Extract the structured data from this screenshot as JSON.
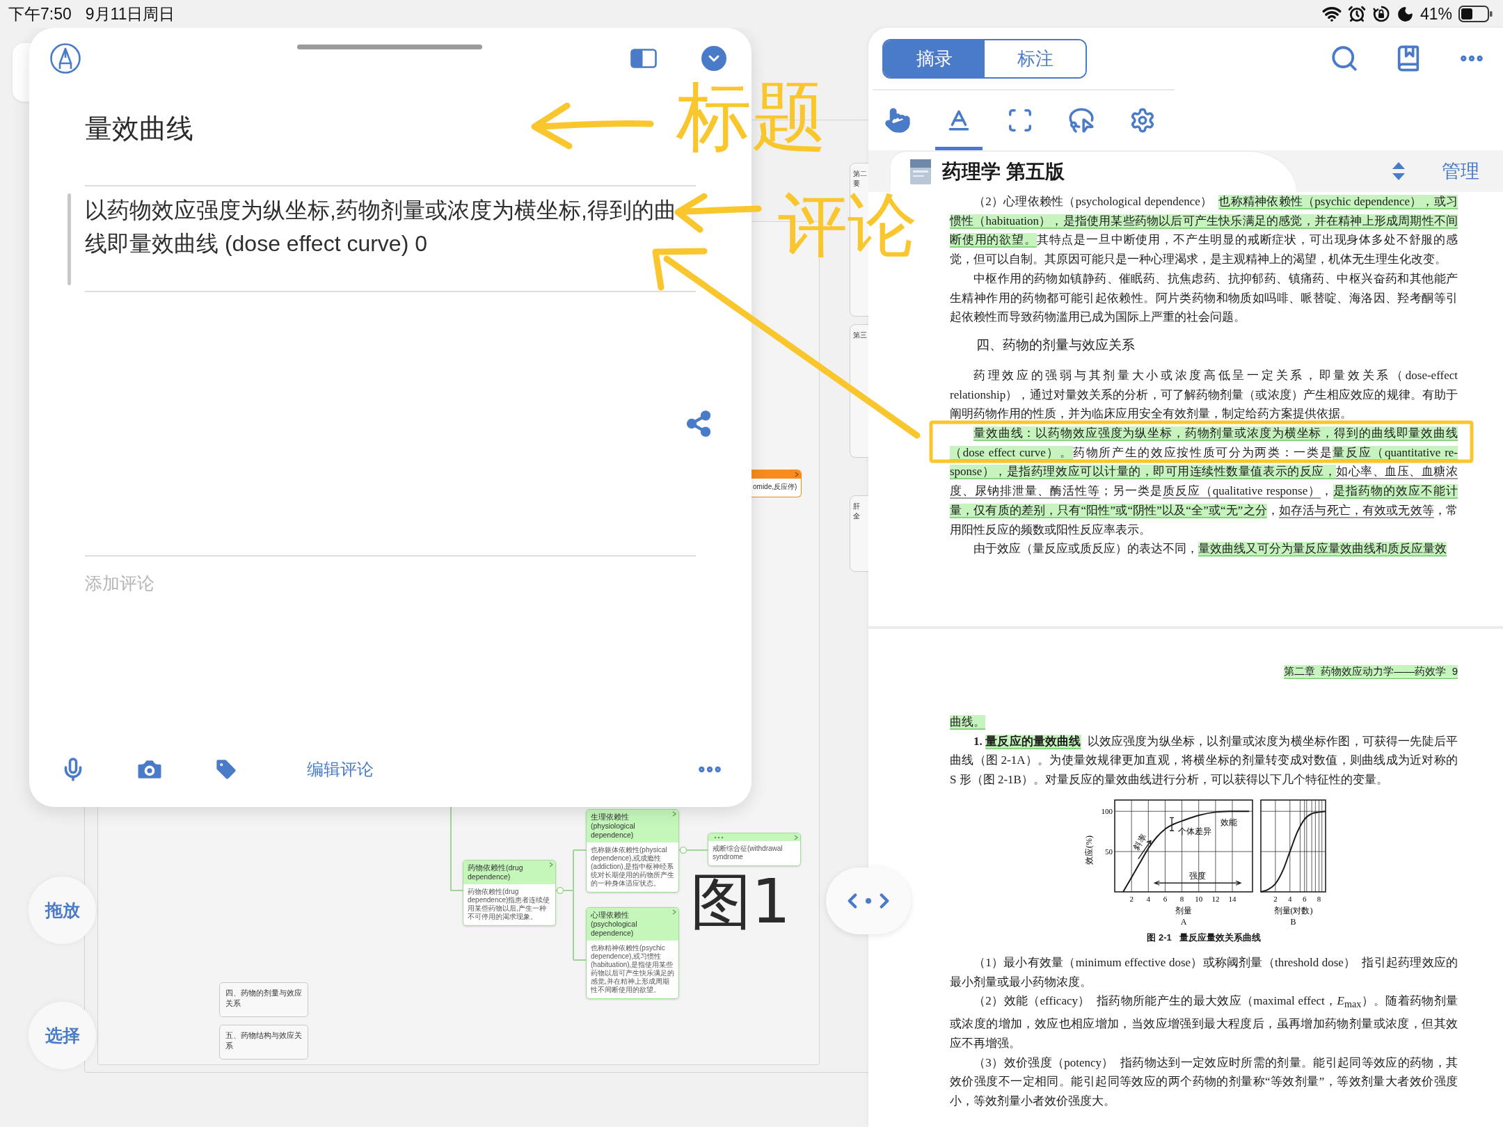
{
  "status_bar": {
    "time": "下午7:50",
    "date": "9月11日周日",
    "battery": "41%"
  },
  "note_card": {
    "title": "量效曲线",
    "excerpt": "以药物效应强度为纵坐标,药物剂量或浓度为横坐标,得到的曲线即量效曲线 (dose effect curve) 0",
    "comment_field": {
      "placeholder": "添加评论"
    },
    "edit_button": "编辑评论"
  },
  "side_buttons": [
    {
      "label": "拖放"
    },
    {
      "label": "选择"
    }
  ],
  "mind_map": {
    "topics": [
      {
        "title": "药物依赖性(drug dependence)",
        "body": "药物依赖性(drug dependence)指患者连续使用某些药物以后,产生一种不可停用的渴求现象。"
      },
      {
        "title": "生理依赖性(physiological dependence)",
        "body": "也称躯体依赖性(physical dependence),或成瘾性(addiction),是指中枢神经系统对长期使用的药物所产生的一种身体适应状态。"
      },
      {
        "title": "心理依赖性(psychological dependence)",
        "body": "也称精神依赖性(psychic dependence),或习惯性(habituation),是指使用某些药物以后可产生快乐满足的感觉,并在精神上形成周期性不间断使用的欲望。"
      }
    ],
    "note": {
      "text": "戒断综合征(withdrawal syndrome"
    },
    "sections": [
      "四、药物的剂量与效应关系",
      "五、药物结构与效应关系"
    ],
    "edge_nodes": [
      {
        "lines": [
          "第二",
          "要"
        ]
      },
      {
        "lines": [
          "第三"
        ]
      },
      {
        "lines": [
          "肝",
          "全"
        ]
      }
    ],
    "marked_node": {
      "text": "omide,反应停)"
    }
  },
  "reader": {
    "tabs": [
      {
        "label": "摘录",
        "selected": true
      },
      {
        "label": "标注",
        "selected": false
      }
    ],
    "tools": [
      {
        "kind": "pointer",
        "selected": false
      },
      {
        "kind": "highlighter",
        "selected": true
      },
      {
        "kind": "area",
        "selected": false
      },
      {
        "kind": "lasso",
        "selected": false
      },
      {
        "kind": "settings",
        "selected": false
      }
    ],
    "book": {
      "title": "药理学 第五版",
      "manage": "管理"
    },
    "pages": [
      {
        "blocks": [
          {
            "kind": "paragraph",
            "segments": [
              {
                "text": "（2）心理依赖性（psychological dependence）  ",
                "kind": "plain"
              },
              {
                "text": "也称精神依赖性（psychic dependence），或习惯性（habituation），是指使用某些药物以后可产生快乐满足的感觉，并在精神上形成周期性不间断使用的欲望。",
                "kind": "highlight"
              },
              {
                "text": "其特点是一旦中断使用，不产生明显的戒断症状，可出现身体多处不舒服的感觉，但可以自制。其原因可能只是一种心理渴求，是主观精神上的渴望，机体无生理生化改变。",
                "kind": "plain"
              }
            ]
          },
          {
            "kind": "paragraph",
            "segments": [
              {
                "text": "中枢作用的药物如镇静药、催眠药、抗焦虑药、抗抑郁药、镇痛药、中枢兴奋药和其他能产生精神作用的药物都可能引起依赖性。阿片类药物和物质如吗啡、哌替啶、海洛因、羟考酮等引起依赖性而导致药物滥用已成为国际上严重的社会问题。",
                "kind": "plain"
              }
            ]
          },
          {
            "kind": "heading",
            "segments": [
              {
                "text": "四、药物的剂量与效应关系",
                "kind": "plain"
              }
            ]
          },
          {
            "kind": "paragraph",
            "segments": [
              {
                "text": "药理效应的强弱与其剂量大小或浓度高低呈一定关系，即量效关系（dose-effect relationship），通过对量效关系的分析，可了解药物剂量（或浓度）产生相应效应的规律。有助于阐明药物作用的性质，并为临床应用安全有效剂量，制定给药方案提供依据。",
                "kind": "plain"
              }
            ]
          },
          {
            "kind": "paragraph",
            "segments": [
              {
                "text": "量效曲线：以药物效应强度为纵坐标，药物剂量或浓度为横坐标，得到的曲线即量效曲线（dose effect curve）。",
                "kind": "highlight"
              },
              {
                "text": "药物所产生的效应按性质可分为两类：一类是",
                "kind": "plain"
              },
              {
                "text": "量反应（quantitative re-sponse），是指药理效应可以计量的，即可用连续性数量值表示的反应，",
                "kind": "highlight"
              },
              {
                "text": "如心率、血压、血糖浓度、尿钠排泄量、酶活性等",
                "kind": "underline"
              },
              {
                "text": "；另一类是",
                "kind": "plain"
              },
              {
                "text": "质反应（qualitative response）",
                "kind": "underline"
              },
              {
                "text": "，",
                "kind": "plain"
              },
              {
                "text": "是指药物的效应不能计量，仅有质的差别，只有“阳性”或“阴性”以及“全”或“无”之分",
                "kind": "highlight"
              },
              {
                "text": "，",
                "kind": "plain"
              },
              {
                "text": "如存活与死亡，有效或无效等",
                "kind": "underline"
              },
              {
                "text": "，常用阳性反应的频数或阳性反应率表示。",
                "kind": "plain"
              }
            ]
          },
          {
            "kind": "paragraph",
            "segments": [
              {
                "text": "由于效应（量反应或质反应）的表达不同，",
                "kind": "plain"
              },
              {
                "text": "量效曲线又可分为量反应量效曲线和质反应量效",
                "kind": "highlight"
              }
            ]
          }
        ]
      },
      {
        "running_head": [
          {
            "text": "第二章  药物效应动力学——药效学  9",
            "kind": "highlight"
          }
        ],
        "blocks": [
          {
            "kind": "continuation",
            "segments": [
              {
                "text": "曲线。",
                "kind": "highlight"
              }
            ]
          },
          {
            "kind": "paragraph",
            "segments": [
              {
                "text": "**1.** ",
                "kind": "plain"
              },
              {
                "text": "**量反应的量效曲线**",
                "kind": "highlight"
              },
              {
                "text": "  以效应强度为纵坐标，以剂量或浓度为横坐标作图，可获得一先陡后平曲线（图 2-1A）。为使量效规律更加直观，将横坐标的剂量转变成对数值，则曲线成为近对称的 S 形（图 2-1B）。对量反应的量效曲线进行分析，可以获得以下几个特征性的变量。",
                "kind": "plain"
              }
            ]
          },
          {
            "kind": "figure",
            "panels": [
              {
                "chart_data": {
                  "type": "line",
                  "title": "A",
                  "xlabel": "剂量",
                  "ylabel": "效应(%)",
                  "x": [
                    1,
                    2,
                    3,
                    4,
                    5,
                    6,
                    7,
                    8,
                    10,
                    12,
                    14,
                    16
                  ],
                  "series": [
                    {
                      "color": "#1a1a1a",
                      "values": [
                        0,
                        18,
                        36,
                        54,
                        68,
                        78,
                        84,
                        88,
                        95,
                        99,
                        100,
                        100
                      ]
                    }
                  ],
                  "xlim": [
                    0,
                    16.4
                  ],
                  "ylim": [
                    0,
                    114
                  ],
                  "xticks": [
                    2,
                    4,
                    6,
                    8,
                    10,
                    12,
                    14
                  ],
                  "yticks": [
                    50,
                    100
                  ],
                  "grid": true,
                  "annotations": [
                    "斜率",
                    "个体差异",
                    "效能",
                    "强度"
                  ]
                }
              },
              {
                "chart_data": {
                  "type": "line",
                  "title": "B",
                  "xlabel": "剂量(对数)",
                  "x": [
                    0,
                    1,
                    2,
                    3,
                    4,
                    5,
                    6,
                    7,
                    8,
                    8.9
                  ],
                  "series": [
                    {
                      "color": "#1a1a1a",
                      "values": [
                        0,
                        3,
                        10,
                        26,
                        50,
                        74,
                        90,
                        97,
                        99,
                        100
                      ]
                    }
                  ],
                  "xlim": [
                    0,
                    8.9
                  ],
                  "ylim": [
                    0,
                    114
                  ],
                  "xticks": [
                    2,
                    4,
                    6,
                    8
                  ],
                  "grid": true
                }
              }
            ]
          },
          {
            "kind": "caption",
            "segments": [
              {
                "text": "图 2-1   量反应量效关系曲线",
                "kind": "plain"
              }
            ]
          },
          {
            "kind": "paragraph",
            "segments": [
              {
                "text": "（1）最小有效量（minimum effective dose）或称阈剂量（threshold dose）  指引起药理效应的最小剂量或最小药物浓度。",
                "kind": "plain"
              }
            ]
          },
          {
            "kind": "paragraph",
            "segments": [
              {
                "text": "（2）效能（efficacy）  指药物所能产生的最大效应（maximal effect，*E*$_{max}$）。随着药物剂量或浓度的增加，效应也相应增加，当效应增强到最大程度后，虽再增加药物剂量或浓度，但其效应不再增强。",
                "kind": "plain"
              }
            ]
          },
          {
            "kind": "paragraph",
            "segments": [
              {
                "text": "（3）效价强度（potency）  指药物达到一定效应时所需的剂量。能引起同等效应的药物，其效价强度不一定相同。能引起同等效应的两个药物的剂量称“等效剂量”，等效剂量大者效价强度小，等效剂量小者效价强度大。",
                "kind": "plain"
              }
            ]
          }
        ]
      }
    ]
  },
  "annotations": [
    {
      "text": "标题",
      "color": "#f9c62e"
    },
    {
      "text": "评论",
      "color": "#f9c62e"
    },
    {
      "text": "图1",
      "color": "#2b2b2b"
    }
  ]
}
